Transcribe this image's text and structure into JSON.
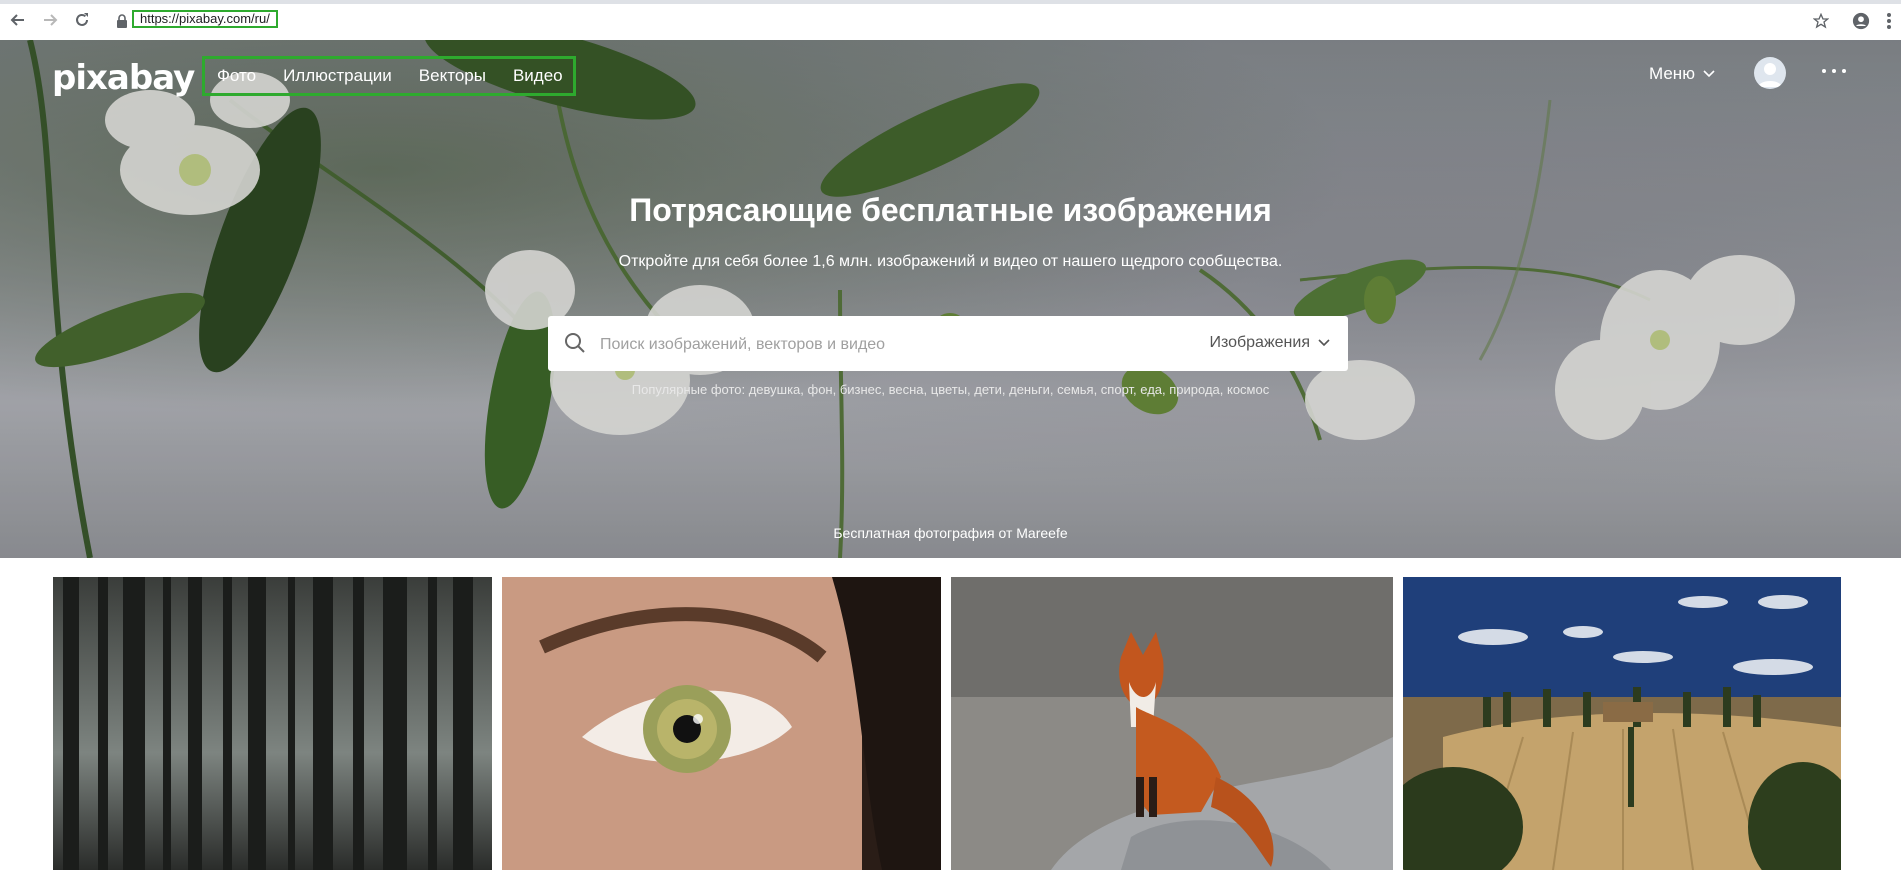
{
  "browser": {
    "url": "https://pixabay.com/ru/",
    "icons": [
      "back-arrow-icon",
      "forward-arrow-icon",
      "reload-icon",
      "lock-icon",
      "star-icon",
      "account-icon",
      "kebab-menu-icon"
    ]
  },
  "header": {
    "logo": "pixabay",
    "nav": [
      "Фото",
      "Иллюстрации",
      "Векторы",
      "Видео"
    ],
    "menu_label": "Меню"
  },
  "hero": {
    "title": "Потрясающие бесплатные изображения",
    "subtitle": "Откройте для себя более 1,6 млн. изображений и видео от нашего щедрого сообщества.",
    "search_placeholder": "Поиск изображений, векторов и видео",
    "search_type": "Изображения",
    "popular": "Популярные фото: девушка, фон, бизнес, весна, цветы, дети, деньги, семья, спорт, еда, природа, космос",
    "credit": "Бесплатная фотография от Mareefe"
  },
  "colors": {
    "highlight": "#2eaa2e",
    "text_white": "#ffffff"
  }
}
